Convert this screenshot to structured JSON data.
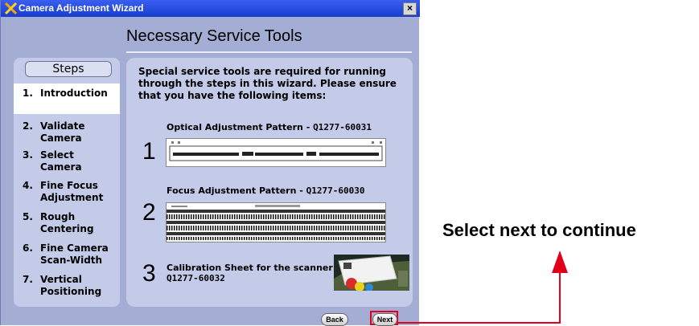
{
  "window": {
    "title": "Camera Adjustment Wizard",
    "close_label": "×",
    "heading": "Necessary Service Tools"
  },
  "steps": {
    "header": "Steps",
    "items": [
      {
        "num": "1.",
        "label": "Introduction",
        "active": true
      },
      {
        "num": "2.",
        "label": "Validate Camera"
      },
      {
        "num": "3.",
        "label": "Select Camera"
      },
      {
        "num": "4.",
        "label": "Fine Focus Adjustment"
      },
      {
        "num": "5.",
        "label": "Rough Centering"
      },
      {
        "num": "6.",
        "label": "Fine Camera Scan-Width"
      },
      {
        "num": "7.",
        "label": "Vertical Positioning"
      }
    ]
  },
  "content": {
    "intro": "Special service tools are required for running through the steps in this wizard. Please ensure that you have the following items:",
    "items": [
      {
        "num": "1",
        "label": "Optical Adjustment Pattern",
        "sep": " - ",
        "part": "Q1277-60031"
      },
      {
        "num": "2",
        "label": "Focus Adjustment Pattern",
        "sep": " - ",
        "part": "Q1277-60030"
      },
      {
        "num": "3",
        "label": "Calibration Sheet for the scanner",
        "part": "Q1277-60032"
      }
    ]
  },
  "buttons": {
    "back": "Back",
    "next": "Next"
  },
  "annotation": {
    "text": "Select next to continue",
    "color": "#e0001b"
  },
  "colors": {
    "window_bg": "#a4add4",
    "panel_bg": "#c4cbe9",
    "titlebar": "#1f45d8"
  }
}
